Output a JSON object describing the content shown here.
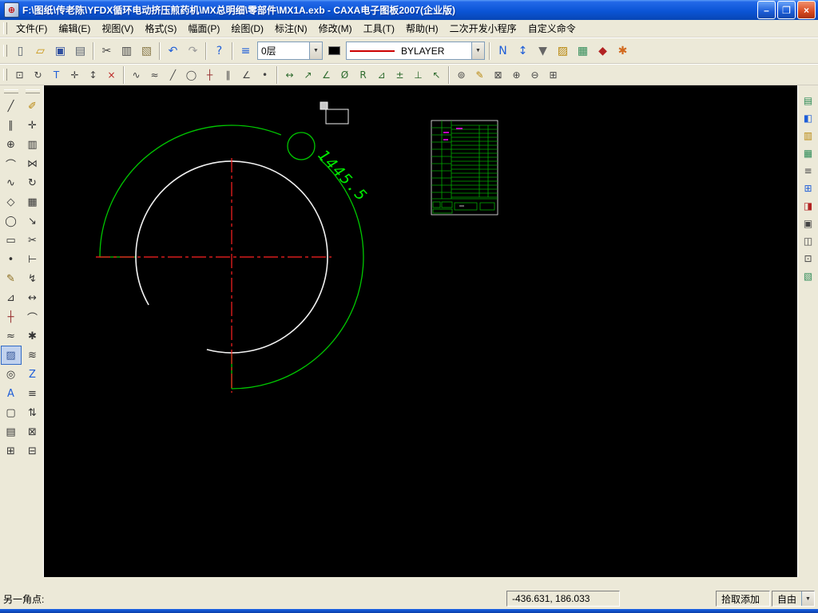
{
  "window": {
    "title": "F:\\图纸\\传老陈\\YFDX循环电动挤压煎药机\\MX总明细\\零部件\\MX1A.exb - CAXA电子图板2007(企业版)",
    "minimize_glyph": "–",
    "restore_glyph": "❐",
    "close_glyph": "×"
  },
  "icons": {
    "combo_arrow": "▼",
    "app_icon_glyph": "⊕"
  },
  "menu": {
    "items": [
      {
        "name": "menu-file",
        "label": "文件(F)"
      },
      {
        "name": "menu-edit",
        "label": "编辑(E)"
      },
      {
        "name": "menu-view",
        "label": "视图(V)"
      },
      {
        "name": "menu-format",
        "label": "格式(S)"
      },
      {
        "name": "menu-sheet",
        "label": "幅面(P)"
      },
      {
        "name": "menu-draw",
        "label": "绘图(D)"
      },
      {
        "name": "menu-dimension",
        "label": "标注(N)"
      },
      {
        "name": "menu-modify",
        "label": "修改(M)"
      },
      {
        "name": "menu-tools",
        "label": "工具(T)"
      },
      {
        "name": "menu-help",
        "label": "帮助(H)"
      },
      {
        "name": "menu-addons",
        "label": "二次开发小程序"
      },
      {
        "name": "menu-custom-command",
        "label": "自定义命令"
      }
    ]
  },
  "toolbar1": {
    "file_group": [
      {
        "name": "new-button",
        "glyph": "▯",
        "color": "#56606e"
      },
      {
        "name": "open-button",
        "glyph": "▱",
        "color": "#c8920a"
      },
      {
        "name": "save-button",
        "glyph": "▣",
        "color": "#2f4f9f"
      },
      {
        "name": "print-button",
        "glyph": "▤",
        "color": "#56606e"
      }
    ],
    "edit_group": [
      {
        "name": "cut-button",
        "glyph": "✂",
        "color": "#444444"
      },
      {
        "name": "copy-button",
        "glyph": "▥",
        "color": "#444444"
      },
      {
        "name": "paste-button",
        "glyph": "▧",
        "color": "#8a7a4a"
      }
    ],
    "undo_group": [
      {
        "name": "undo-button",
        "glyph": "↶",
        "color": "#1e5ed8"
      },
      {
        "name": "redo-button",
        "glyph": "↷",
        "color": "#9a9a9a"
      }
    ],
    "help_group": [
      {
        "name": "help-button",
        "glyph": "?",
        "color": "#1e5ed8"
      }
    ],
    "layer_button_glyph": "≡",
    "layer_value": "0层",
    "linetype_value": "BYLAYER",
    "tail_group": [
      {
        "name": "nav-toggle-button",
        "glyph": "N",
        "color": "#1e5ed8"
      },
      {
        "name": "snap-mode-button",
        "glyph": "↕",
        "color": "#1e5ed8"
      },
      {
        "name": "pick-filter-button",
        "glyph": "▼",
        "color": "#666666"
      },
      {
        "name": "style-manager-button",
        "glyph": "▨",
        "color": "#b8860b"
      },
      {
        "name": "module-manager-button",
        "glyph": "▦",
        "color": "#2e8b57"
      },
      {
        "name": "options-button",
        "glyph": "◆",
        "color": "#b22222"
      },
      {
        "name": "wizard-button",
        "glyph": "✱",
        "color": "#d2691e"
      }
    ]
  },
  "toolbar2": {
    "display_group": [
      {
        "name": "show-all-button",
        "glyph": "⊡",
        "color": "#444444"
      },
      {
        "name": "redraw-button",
        "glyph": "↻",
        "color": "#444444"
      },
      {
        "name": "text-display-button",
        "glyph": "T",
        "color": "#1e5ed8"
      },
      {
        "name": "dynamic-pan-button",
        "glyph": "✛",
        "color": "#444444"
      },
      {
        "name": "dynamic-zoom-button",
        "glyph": "↕",
        "color": "#444444"
      },
      {
        "name": "regen-button",
        "glyph": "×",
        "color": "#bb2222"
      }
    ],
    "draw_group": [
      {
        "name": "spline-button",
        "glyph": "∿",
        "color": "#444444"
      },
      {
        "name": "wave-line-button",
        "glyph": "≈",
        "color": "#444444"
      },
      {
        "name": "two-point-line-button",
        "glyph": "╱",
        "color": "#444444"
      },
      {
        "name": "tangent-circle-button",
        "glyph": "◯",
        "color": "#444444"
      },
      {
        "name": "center-line-button",
        "glyph": "┼",
        "color": "#993333"
      },
      {
        "name": "equidistant-line-button",
        "glyph": "∥",
        "color": "#444444"
      },
      {
        "name": "angle-line-button",
        "glyph": "∠",
        "color": "#444444"
      },
      {
        "name": "point-button",
        "glyph": "•",
        "color": "#444444"
      }
    ],
    "dim_group": [
      {
        "name": "linear-dim-button",
        "glyph": "↔",
        "color": "#2e6b2e"
      },
      {
        "name": "aligned-dim-button",
        "glyph": "↗",
        "color": "#2e6b2e"
      },
      {
        "name": "angle-dim-button",
        "glyph": "∠",
        "color": "#2e6b2e"
      },
      {
        "name": "diameter-dim-button",
        "glyph": "Ø",
        "color": "#2e6b2e"
      },
      {
        "name": "radius-dim-button",
        "glyph": "R",
        "color": "#2e6b2e"
      },
      {
        "name": "chamfer-dim-button",
        "glyph": "⊿",
        "color": "#2e6b2e"
      },
      {
        "name": "tolerance-dim-button",
        "glyph": "±",
        "color": "#2e6b2e"
      },
      {
        "name": "datum-dim-button",
        "glyph": "⊥",
        "color": "#2e6b2e"
      },
      {
        "name": "leader-dim-button",
        "glyph": "↖",
        "color": "#2e6b2e"
      }
    ],
    "zoom_group": [
      {
        "name": "zoom-select-button",
        "glyph": "⊚",
        "color": "#444444"
      },
      {
        "name": "edit-pen-button",
        "glyph": "✎",
        "color": "#b8860b"
      },
      {
        "name": "erase-button",
        "glyph": "⊠",
        "color": "#444444"
      },
      {
        "name": "zoom-in-button",
        "glyph": "⊕",
        "color": "#444444"
      },
      {
        "name": "zoom-out-button",
        "glyph": "⊖",
        "color": "#444444"
      },
      {
        "name": "zoom-extent-button",
        "glyph": "⊞",
        "color": "#444444"
      }
    ]
  },
  "left_toolbar": {
    "col1": [
      {
        "name": "line-tool",
        "glyph": "╱",
        "color": "#333333"
      },
      {
        "name": "parallel-line-tool",
        "glyph": "∥",
        "color": "#333333"
      },
      {
        "name": "circle-tool",
        "glyph": "⊕",
        "color": "#333333"
      },
      {
        "name": "arc-tool",
        "glyph": "⌒",
        "color": "#333333"
      },
      {
        "name": "spline-tool",
        "glyph": "∿",
        "color": "#333333"
      },
      {
        "name": "polygon-tool",
        "glyph": "◇",
        "color": "#333333"
      },
      {
        "name": "ellipse-tool",
        "glyph": "◯",
        "color": "#333333"
      },
      {
        "name": "rectangle-tool",
        "glyph": "▭",
        "color": "#333333"
      },
      {
        "name": "point-tool",
        "glyph": "•",
        "color": "#333333"
      },
      {
        "name": "sketch-tool",
        "glyph": "✎",
        "color": "#8a6a1a"
      },
      {
        "name": "chamfer-tool",
        "glyph": "⊿",
        "color": "#333333"
      },
      {
        "name": "center-axis-tool",
        "glyph": "┼",
        "color": "#993333"
      },
      {
        "name": "wave-line-tool",
        "glyph": "≈",
        "color": "#333333"
      },
      {
        "name": "hatch-tool",
        "glyph": "▨",
        "color": "#335599",
        "selected": true
      },
      {
        "name": "detail-view-tool",
        "glyph": "◎",
        "color": "#333333"
      },
      {
        "name": "text-tool",
        "glyph": "A",
        "color": "#1e5ed8"
      },
      {
        "name": "frame-tool",
        "glyph": "▢",
        "color": "#333333"
      },
      {
        "name": "title-block-tool",
        "glyph": "▤",
        "color": "#333333"
      },
      {
        "name": "block-tool",
        "glyph": "⊞",
        "color": "#333333"
      }
    ],
    "col2": [
      {
        "name": "property-brush-tool",
        "glyph": "✐",
        "color": "#b8860b"
      },
      {
        "name": "move-tool",
        "glyph": "✛",
        "color": "#333333"
      },
      {
        "name": "copy-tool",
        "glyph": "▥",
        "color": "#333333"
      },
      {
        "name": "mirror-tool",
        "glyph": "⋈",
        "color": "#333333"
      },
      {
        "name": "rotate-tool",
        "glyph": "↻",
        "color": "#333333"
      },
      {
        "name": "array-tool",
        "glyph": "▦",
        "color": "#333333"
      },
      {
        "name": "scale-tool",
        "glyph": "↘",
        "color": "#333333"
      },
      {
        "name": "trim-tool",
        "glyph": "✂",
        "color": "#333333"
      },
      {
        "name": "extend-tool",
        "glyph": "⊢",
        "color": "#333333"
      },
      {
        "name": "break-tool",
        "glyph": "↯",
        "color": "#333333"
      },
      {
        "name": "stretch-tool",
        "glyph": "↔",
        "color": "#333333"
      },
      {
        "name": "fillet-tool",
        "glyph": "⌒",
        "color": "#333333"
      },
      {
        "name": "explode-tool",
        "glyph": "✱",
        "color": "#333333"
      },
      {
        "name": "offset-tool",
        "glyph": "≋",
        "color": "#333333"
      },
      {
        "name": "hide-tool",
        "glyph": "Z",
        "color": "#1e5ed8"
      },
      {
        "name": "align-tool",
        "glyph": "≡",
        "color": "#333333"
      },
      {
        "name": "flip-tool",
        "glyph": "⇅",
        "color": "#333333"
      },
      {
        "name": "make-block-tool",
        "glyph": "⊠",
        "color": "#333333"
      },
      {
        "name": "group-tool",
        "glyph": "⊟",
        "color": "#333333"
      }
    ]
  },
  "right_toolbar": {
    "items": [
      {
        "name": "sheet-operations-button",
        "glyph": "▤",
        "color": "#2e8b57"
      },
      {
        "name": "view-3d-button",
        "glyph": "◧",
        "color": "#1e5ed8"
      },
      {
        "name": "paste-special-button",
        "glyph": "▥",
        "color": "#b8860b"
      },
      {
        "name": "part-library-button",
        "glyph": "▦",
        "color": "#2e8b57"
      },
      {
        "name": "layer-manager-button",
        "glyph": "≡",
        "color": "#444444"
      },
      {
        "name": "block-manager-button",
        "glyph": "⊞",
        "color": "#1e5ed8"
      },
      {
        "name": "ole-object-button",
        "glyph": "◨",
        "color": "#b22222"
      },
      {
        "name": "table-button",
        "glyph": "▣",
        "color": "#444444"
      },
      {
        "name": "dim-style-button",
        "glyph": "◫",
        "color": "#444444"
      },
      {
        "name": "system-settings-button",
        "glyph": "⊡",
        "color": "#444444"
      },
      {
        "name": "symbol-library-button",
        "glyph": "▧",
        "color": "#2e8b57"
      }
    ]
  },
  "canvas": {
    "dimension_text": "1445.5",
    "colors": {
      "geometry": "#00c800",
      "dimension": "#00ee00",
      "centerline": "#ff2222",
      "outline": "#f2f2f2",
      "table": "#00aa00",
      "highlight": "#ff00ff"
    }
  },
  "statusbar": {
    "prompt": "另一角点:",
    "coordinates": "-436.631, 186.033",
    "pick_mode": "拾取添加",
    "snap_mode": "自由"
  }
}
